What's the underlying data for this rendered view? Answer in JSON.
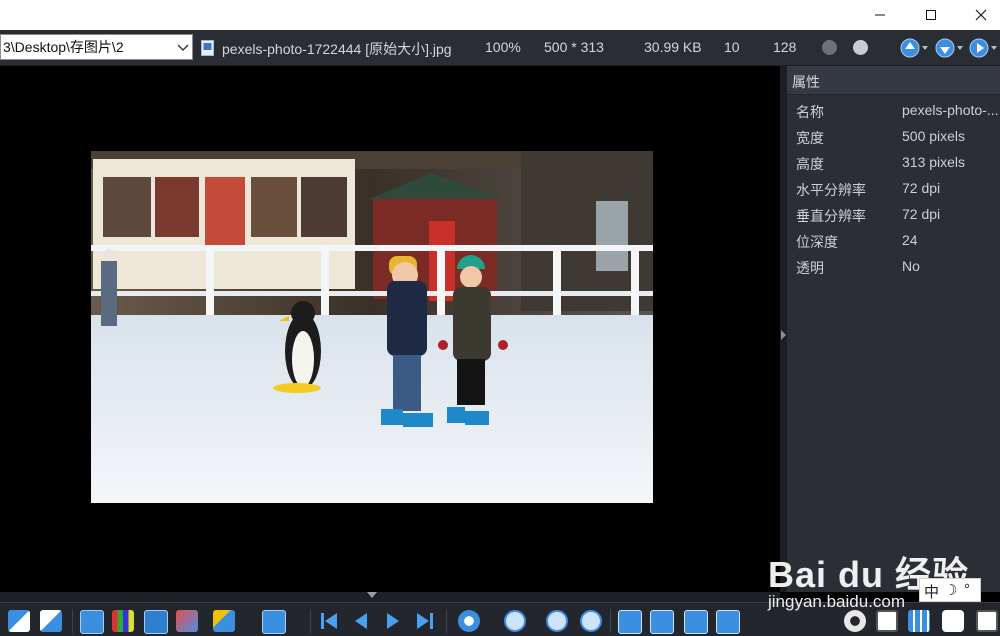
{
  "window": {
    "minimize_icon": "minimize-icon",
    "maximize_icon": "maximize-icon",
    "close_icon": "close-icon"
  },
  "infobar": {
    "path": "3\\Desktop\\存图片\\2",
    "file_name": "pexels-photo-1722444 [原始大小].jpg",
    "zoom": "100%",
    "dimensions": "500 * 313",
    "file_size": "30.99 KB",
    "index": "10",
    "total": "128"
  },
  "panel": {
    "title": "属性",
    "properties": [
      {
        "key": "名称",
        "value": "pexels-photo-..."
      },
      {
        "key": "宽度",
        "value": "500 pixels"
      },
      {
        "key": "高度",
        "value": "313 pixels"
      },
      {
        "key": "水平分辨率",
        "value": "72 dpi"
      },
      {
        "key": "垂直分辨率",
        "value": "72 dpi"
      },
      {
        "key": "位深度",
        "value": "24"
      },
      {
        "key": "透明",
        "value": "No"
      }
    ]
  },
  "toolbar": {
    "icons": [
      "thumbnails-icon",
      "grid-icon",
      "move-icon",
      "histogram-icon",
      "export-icon",
      "resize-icon",
      "edit-icon",
      "goto-icon",
      "first-icon",
      "prev-icon",
      "next-icon",
      "last-icon",
      "settings-icon",
      "zoom-out-icon",
      "zoom-minus-icon",
      "zoom-in-icon",
      "fit-icon",
      "actual-size-icon",
      "fit-width-icon",
      "fit-height-icon",
      "gear-icon",
      "layout-icon",
      "grid-view-icon",
      "eye-icon",
      "fullscreen-icon"
    ]
  },
  "watermark": {
    "main": "Bai du 经验",
    "sub": "jingyan.baidu.com"
  },
  "ime": {
    "lang": "中",
    "moon": "☽",
    "dot": "°"
  },
  "colors": {
    "panel_bg": "#2b2e35",
    "infobar_bg": "#2a2d34",
    "accent_blue": "#3b8fe0"
  }
}
